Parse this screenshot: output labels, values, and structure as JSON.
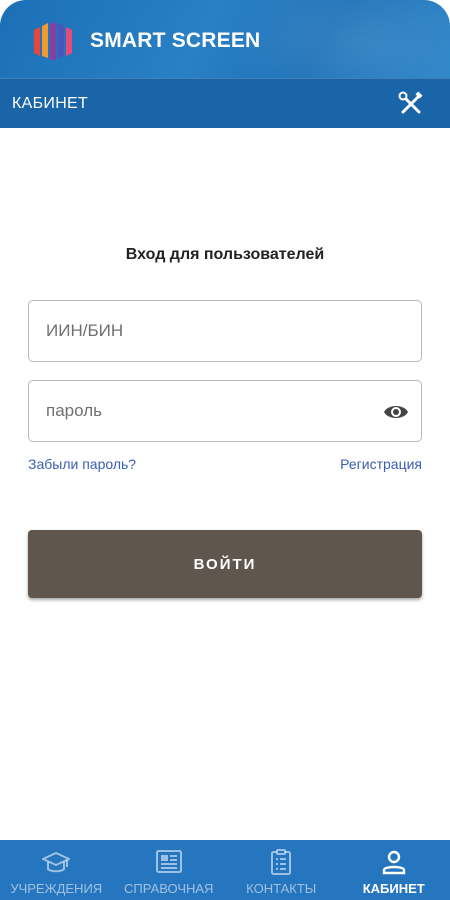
{
  "app": {
    "name": "SMART SCREEN"
  },
  "header": {
    "title": "КАБИНЕТ",
    "tools_icon": "wrench-screwdriver-icon"
  },
  "login": {
    "heading": "Вход для пользователей",
    "login_field": {
      "value": "",
      "placeholder": "ИИН/БИН"
    },
    "password_field": {
      "value": "",
      "placeholder": "пароль",
      "toggle_icon": "eye-icon"
    },
    "forgot_link": "Забыли пароль?",
    "register_link": "Регистрация",
    "submit_label": "ВОЙТИ"
  },
  "tabs": [
    {
      "label": "УЧРЕЖДЕНИЯ",
      "icon": "graduation-cap-icon",
      "active": false
    },
    {
      "label": "СПРАВОЧНАЯ",
      "icon": "newspaper-icon",
      "active": false
    },
    {
      "label": "КОНТАКТЫ",
      "icon": "clipboard-list-icon",
      "active": false
    },
    {
      "label": "КАБИНЕТ",
      "icon": "user-icon",
      "active": true
    }
  ],
  "colors": {
    "header_blue": "#1c6fb6",
    "nav_blue": "#1a64a8",
    "tab_blue": "#2676bf",
    "button_brown": "#5f574e",
    "link_blue": "#3a5fb0"
  }
}
